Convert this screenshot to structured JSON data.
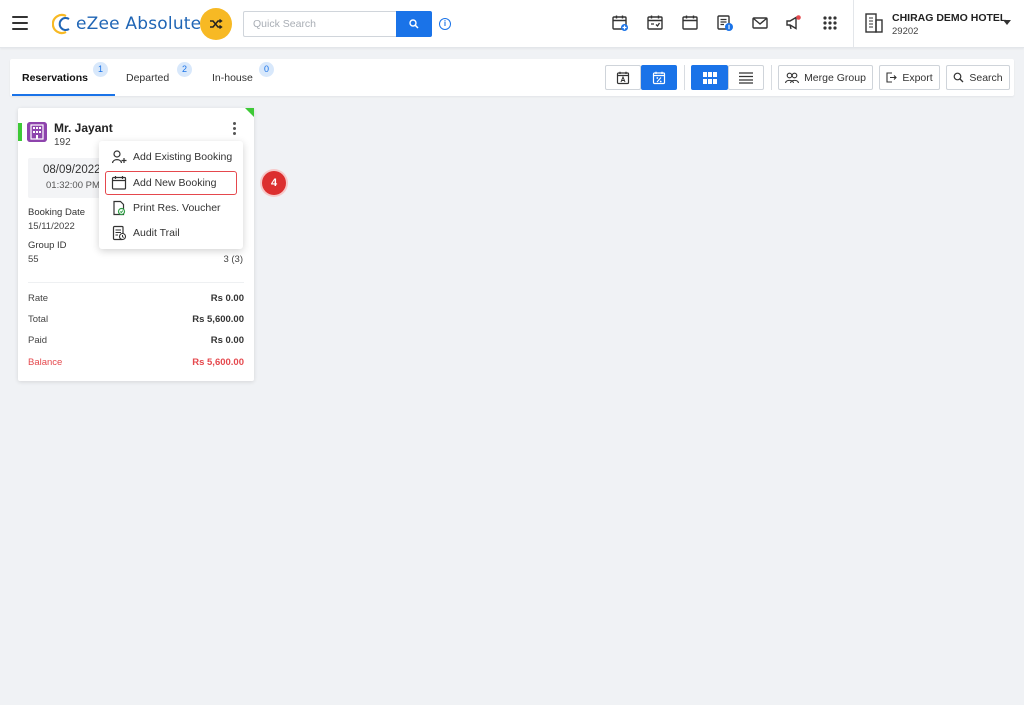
{
  "header": {
    "app_name": "eZee Absolute",
    "search": {
      "placeholder": "Quick Search",
      "value": ""
    },
    "hotel": {
      "name": "CHIRAG DEMO HOTEL",
      "code": "29202"
    },
    "icons": [
      "calendar-add-icon",
      "calendar-check-icon",
      "calendar-icon",
      "invoice-icon",
      "mail-icon",
      "announcement-icon",
      "apps-grid-icon"
    ],
    "colors": {
      "brand": "#1f65b5",
      "accent": "#1a73e8",
      "shuffle": "#f7b924"
    }
  },
  "tabs": [
    {
      "label": "Reservations",
      "count": "1",
      "active": true
    },
    {
      "label": "Departed",
      "count": "2",
      "active": false
    },
    {
      "label": "In-house",
      "count": "0",
      "active": false
    }
  ],
  "toolbar": {
    "merge_group": "Merge Group",
    "export": "Export",
    "search": "Search"
  },
  "card": {
    "guest_name": "Mr. Jayant",
    "guest_number": "192",
    "arrival_date": "08/09/2022",
    "arrival_time": "01:32:00 PM",
    "booking_date_label": "Booking Date",
    "booking_date": "15/11/2022",
    "group_id_label": "Group ID",
    "group_id": "55",
    "rooms": "3 (3)",
    "rate_label": "Rate",
    "rate": "Rs 0.00",
    "total_label": "Total",
    "total": "Rs 5,600.00",
    "paid_label": "Paid",
    "paid": "Rs 0.00",
    "balance_label": "Balance",
    "balance": "Rs 5,600.00",
    "status_color": "#3ec937",
    "balance_color": "#e5484d"
  },
  "menu": {
    "items": [
      {
        "label": "Add Existing Booking",
        "icon": "add-user-icon"
      },
      {
        "label": "Add New Booking",
        "icon": "calendar-icon",
        "highlighted": true
      },
      {
        "label": "Print Res. Voucher",
        "icon": "print-document-icon"
      },
      {
        "label": "Audit Trail",
        "icon": "audit-document-icon"
      }
    ]
  },
  "step_badge": "4"
}
